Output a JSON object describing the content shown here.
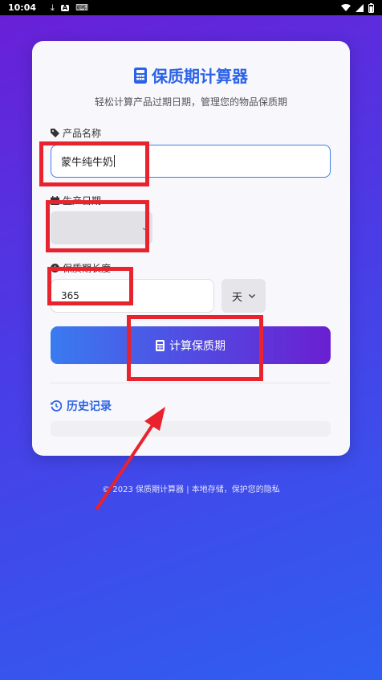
{
  "status_bar": {
    "time": "10:04"
  },
  "app": {
    "title": "保质期计算器",
    "subtitle": "轻松计算产品过期日期，管理您的物品保质期"
  },
  "form": {
    "name_label": "产品名称",
    "name_value": "蒙牛纯牛奶",
    "date_label": "生产日期",
    "length_label": "保质期长度",
    "length_value": "365",
    "unit_value": "天",
    "calc_button": "计算保质期"
  },
  "history": {
    "title": "历史记录"
  },
  "footer": {
    "text": "© 2023 保质期计算器 | 本地存储，保护您的隐私"
  },
  "colors": {
    "accent": "#2c63e6",
    "annotation": "#e8232e"
  }
}
